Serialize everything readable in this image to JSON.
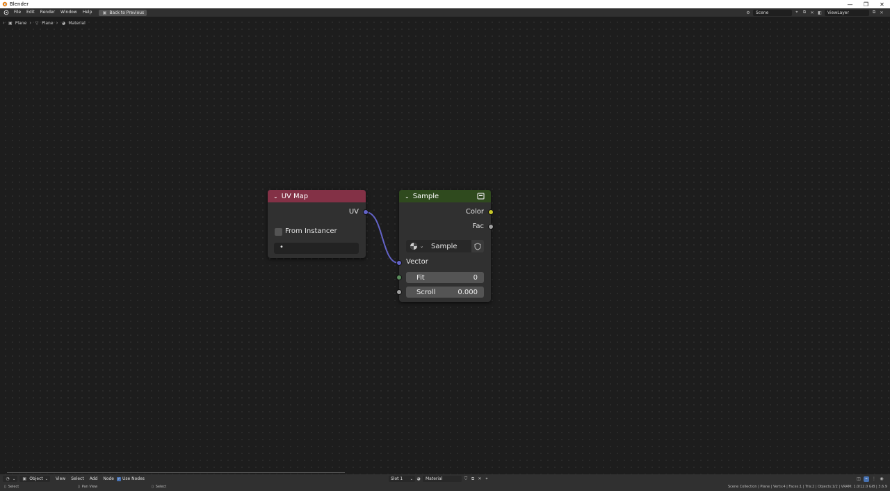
{
  "window": {
    "title": "Blender",
    "controls": [
      "—",
      "❐",
      "✕"
    ]
  },
  "menubar": {
    "items": [
      "File",
      "Edit",
      "Render",
      "Window",
      "Help"
    ],
    "back_button": "Back to Previous",
    "scene": "Scene",
    "view_layer": "ViewLayer"
  },
  "breadcrumb": {
    "object": "Plane",
    "mesh": "Plane",
    "material": "Material"
  },
  "nodes": {
    "uvmap": {
      "title": "UV Map",
      "output": "UV",
      "from_instancer_label": "From Instancer",
      "uv_field_value": "•",
      "color": "#833146"
    },
    "sample": {
      "title": "Sample",
      "outputs": [
        "Color",
        "Fac"
      ],
      "image_name": "Sample",
      "vector_label": "Vector",
      "fit_label": "Fit",
      "fit_value": "0",
      "scroll_label": "Scroll",
      "scroll_value": "0.000",
      "color": "#2f4a1e"
    }
  },
  "bottombar": {
    "mode": "Object",
    "items": [
      "View",
      "Select",
      "Add",
      "Node"
    ],
    "use_nodes_label": "Use Nodes",
    "use_nodes_checked": true,
    "slot": "Slot 1",
    "material": "Material"
  },
  "statusbar": {
    "left": "Select",
    "middle": "Pan View",
    "right_select": "Select",
    "stats": "Scene Collection | Plane | Verts:4 | Faces:1 | Tris:2 | Objects:1/2 | VRAM: 1.0/12.0 GiB | 3.6.9"
  },
  "socket_colors": {
    "vector": "#6363c7",
    "color": "#c7c729",
    "float": "#a1a1a1",
    "int": "#598c5c"
  }
}
